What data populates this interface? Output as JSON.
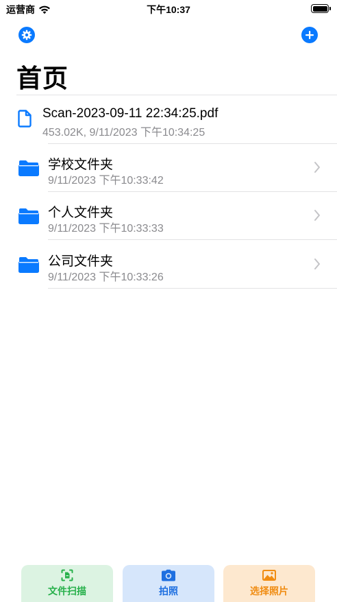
{
  "status_bar": {
    "carrier": "运营商",
    "time": "下午10:37"
  },
  "header": {
    "title": "首页",
    "settings_icon": "gear-icon",
    "add_icon": "plus-circle-icon"
  },
  "items": [
    {
      "type": "file",
      "name": "Scan-2023-09-11 22:34:25.pdf",
      "meta": "453.02K, 9/11/2023 下午10:34:25",
      "icon": "document-icon"
    },
    {
      "type": "folder",
      "name": "学校文件夹",
      "meta": "9/11/2023 下午10:33:42",
      "icon": "folder-icon"
    },
    {
      "type": "folder",
      "name": "个人文件夹",
      "meta": "9/11/2023 下午10:33:33",
      "icon": "folder-icon"
    },
    {
      "type": "folder",
      "name": "公司文件夹",
      "meta": "9/11/2023 下午10:33:26",
      "icon": "folder-icon"
    }
  ],
  "bottom_bar": {
    "scan_label": "文件扫描",
    "camera_label": "拍照",
    "pick_label": "选择照片"
  },
  "colors": {
    "accent": "#0a7aff",
    "scan_green": "#27b04b",
    "camera_blue": "#1e6fe0",
    "pick_orange": "#f08c12"
  }
}
